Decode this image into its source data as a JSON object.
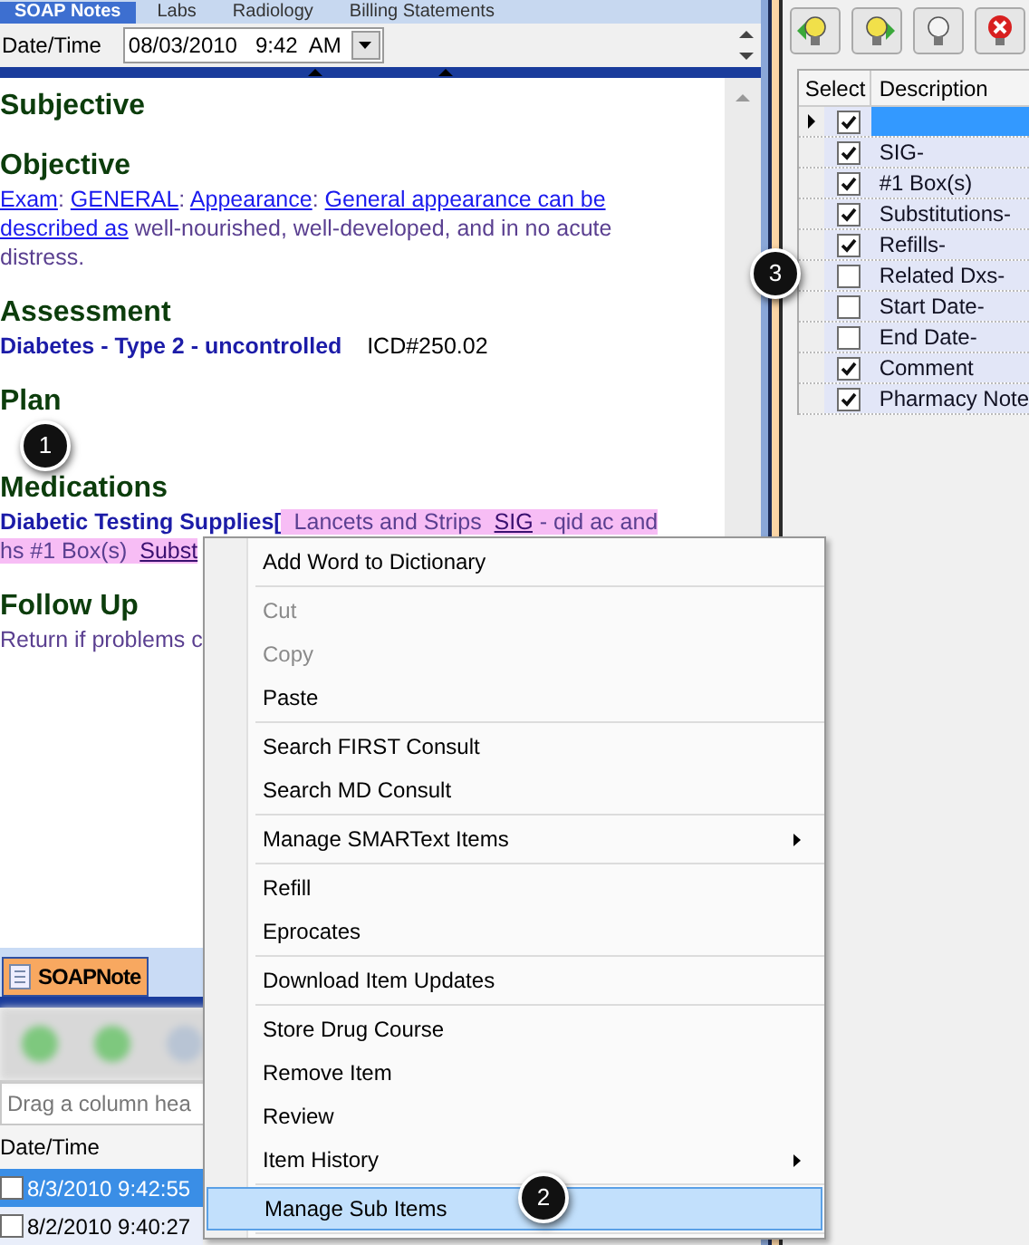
{
  "top_tabs": [
    {
      "label": "SOAP Notes",
      "selected": true
    },
    {
      "label": "Labs",
      "selected": false
    },
    {
      "label": "Radiology",
      "selected": false
    },
    {
      "label": "Billing Statements",
      "selected": false
    }
  ],
  "date_time": {
    "label": "Date/Time",
    "value": "08/03/2010   9:42  AM"
  },
  "note_sections": [
    {
      "heading": "Subjective"
    },
    {
      "heading": "Objective",
      "lines": [
        [
          {
            "kind": "link",
            "text": "Exam"
          },
          {
            "kind": "text",
            "text": ": "
          },
          {
            "kind": "link",
            "text": "GENERAL"
          },
          {
            "kind": "text",
            "text": ": "
          },
          {
            "kind": "link",
            "text": "Appearance"
          },
          {
            "kind": "text",
            "text": ": "
          },
          {
            "kind": "link",
            "text": "General appearance can be"
          }
        ],
        [
          {
            "kind": "link",
            "text": "described as"
          },
          {
            "kind": "text",
            "text": " well-nourished, well-developed, and in no acute"
          }
        ],
        [
          {
            "kind": "text",
            "text": "distress."
          }
        ]
      ]
    },
    {
      "heading": "Assessment",
      "lines": [
        [
          {
            "kind": "term",
            "text": "Diabetes - Type 2 - uncontrolled"
          },
          {
            "kind": "plain",
            "text": "    ICD#250.02"
          }
        ]
      ]
    },
    {
      "heading": "Plan"
    },
    {
      "heading": "Medications",
      "lines": [
        [
          {
            "kind": "term",
            "text": "Diabetic Testing Supplies["
          },
          {
            "kind": "highlight",
            "text": "  Lancets and Strips  "
          },
          {
            "kind": "highlight_link",
            "text": "SIG"
          },
          {
            "kind": "highlight",
            "text": " - qid ac and"
          }
        ],
        [
          {
            "kind": "highlight",
            "text": "hs #1 Box(s)  "
          },
          {
            "kind": "highlight_link",
            "text": "Subst"
          }
        ]
      ]
    },
    {
      "heading": "Follow Up",
      "lines": [
        [
          {
            "kind": "text",
            "text": "Return if problems c"
          }
        ]
      ]
    }
  ],
  "bottom_tab": {
    "label": "SOAPNote",
    "selected": true
  },
  "group_hint": "Drag a column hea",
  "history_table": {
    "column": "Date/Time",
    "rows": [
      {
        "value": "8/3/2010 9:42:55",
        "selected": true,
        "checked": false
      },
      {
        "value": "8/2/2010 9:40:27",
        "selected": false,
        "checked": false
      }
    ]
  },
  "sub_items_grid": {
    "columns": [
      "Select",
      "Description"
    ],
    "rows": [
      {
        "checked": true,
        "description": "",
        "selected": true
      },
      {
        "checked": true,
        "description": "SIG-",
        "selected": false
      },
      {
        "checked": true,
        "description": "#1 Box(s)",
        "selected": false
      },
      {
        "checked": true,
        "description": "Substitutions-",
        "selected": false
      },
      {
        "checked": true,
        "description": "Refills-",
        "selected": false
      },
      {
        "checked": false,
        "description": "Related Dxs-",
        "selected": false
      },
      {
        "checked": false,
        "description": "Start Date-",
        "selected": false
      },
      {
        "checked": false,
        "description": "End Date-",
        "selected": false
      },
      {
        "checked": true,
        "description": "Comment",
        "selected": false
      },
      {
        "checked": true,
        "description": "Pharmacy Note",
        "selected": false
      }
    ]
  },
  "context_menu": [
    {
      "kind": "item",
      "label": "Add Word to Dictionary",
      "disabled": false,
      "submenu": false,
      "selected": false
    },
    {
      "kind": "separator"
    },
    {
      "kind": "item",
      "label": "Cut",
      "disabled": true,
      "submenu": false,
      "selected": false
    },
    {
      "kind": "item",
      "label": "Copy",
      "disabled": true,
      "submenu": false,
      "selected": false
    },
    {
      "kind": "item",
      "label": "Paste",
      "disabled": false,
      "submenu": false,
      "selected": false
    },
    {
      "kind": "separator"
    },
    {
      "kind": "item",
      "label": "Search FIRST Consult",
      "disabled": false,
      "submenu": false,
      "selected": false
    },
    {
      "kind": "item",
      "label": "Search MD Consult",
      "disabled": false,
      "submenu": false,
      "selected": false
    },
    {
      "kind": "separator"
    },
    {
      "kind": "item",
      "label": "Manage SMARText Items",
      "disabled": false,
      "submenu": true,
      "selected": false
    },
    {
      "kind": "separator"
    },
    {
      "kind": "item",
      "label": "Refill",
      "disabled": false,
      "submenu": false,
      "selected": false
    },
    {
      "kind": "item",
      "label": "Eprocates",
      "disabled": false,
      "submenu": false,
      "selected": false
    },
    {
      "kind": "separator"
    },
    {
      "kind": "item",
      "label": "Download Item Updates",
      "disabled": false,
      "submenu": false,
      "selected": false
    },
    {
      "kind": "separator"
    },
    {
      "kind": "item",
      "label": "Store Drug Course",
      "disabled": false,
      "submenu": false,
      "selected": false
    },
    {
      "kind": "item",
      "label": "Remove Item",
      "disabled": false,
      "submenu": false,
      "selected": false
    },
    {
      "kind": "item",
      "label": "Review",
      "disabled": false,
      "submenu": false,
      "selected": false
    },
    {
      "kind": "item",
      "label": "Item History",
      "disabled": false,
      "submenu": true,
      "selected": false
    },
    {
      "kind": "separator"
    },
    {
      "kind": "item",
      "label": "Manage Sub Items",
      "disabled": false,
      "submenu": false,
      "selected": true
    },
    {
      "kind": "separator"
    }
  ],
  "callouts": [
    {
      "number": "1"
    },
    {
      "number": "2"
    },
    {
      "number": "3"
    }
  ]
}
